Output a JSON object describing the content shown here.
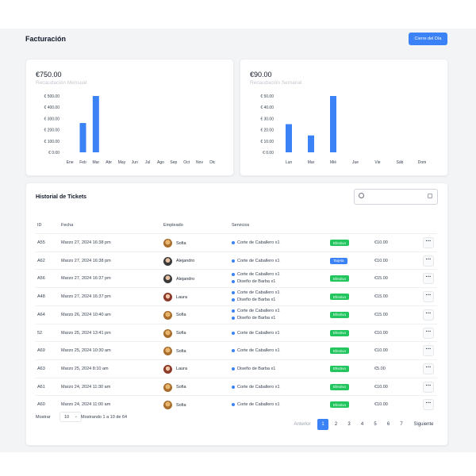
{
  "header": {
    "title": "Facturación",
    "close_button": "Cierre del Día"
  },
  "cards": [
    {
      "value": "€750.00",
      "label": "Recaudación Mensual"
    },
    {
      "value": "€90.00",
      "label": "Recaudación Semanal"
    }
  ],
  "colors": {
    "accent": "#3b82f6",
    "success": "#22c55e",
    "background": "#f3f4f6"
  },
  "chart_data": [
    {
      "type": "bar",
      "categories": [
        "Ene",
        "Feb",
        "Mar",
        "Abr",
        "May",
        "Jun",
        "Jul",
        "Ago",
        "Sep",
        "Oct",
        "Nov",
        "Dic"
      ],
      "values": [
        0,
        260,
        500,
        0,
        0,
        0,
        0,
        0,
        0,
        0,
        0,
        0
      ],
      "yticks": [
        "€ 500.00",
        "€ 400.00",
        "€ 300.00",
        "€ 200.00",
        "€ 100.00",
        "€ 0.00"
      ],
      "ylim": [
        0,
        500
      ],
      "grid": false
    },
    {
      "type": "bar",
      "categories": [
        "Lun",
        "Mar",
        "Mié",
        "Jue",
        "Vie",
        "Sáb",
        "Dom"
      ],
      "values": [
        25,
        15,
        50,
        0,
        0,
        0,
        0
      ],
      "yticks": [
        "€ 50.00",
        "€ 40.00",
        "€ 30.00",
        "€ 20.00",
        "€ 10.00",
        "€ 0.00"
      ],
      "ylim": [
        0,
        50
      ],
      "grid": false
    }
  ],
  "history": {
    "title": "Historial de Tickets",
    "columns": [
      "ID",
      "Fecha",
      "Empleado",
      "Servicios"
    ],
    "rows": [
      {
        "id": "A55",
        "date": "Marzo 27, 2024 16:38 pm",
        "employee": "Sofia",
        "avatar": "gold",
        "services": [
          "Corte de Caballero x1"
        ],
        "payment": "Efectivo",
        "amount": "€10.00"
      },
      {
        "id": "A62",
        "date": "Marzo 27, 2024 16:38 pm",
        "employee": "Alejandro",
        "avatar": "dark",
        "services": [
          "Corte de Caballero x1"
        ],
        "payment": "Tarjeta",
        "amount": "€10.00"
      },
      {
        "id": "A56",
        "date": "Marzo 27, 2024 16:37 pm",
        "employee": "Alejandro",
        "avatar": "dark",
        "services": [
          "Corte de Caballero x1",
          "Diseño de Barba x1"
        ],
        "payment": "Efectivo",
        "amount": "€15.00"
      },
      {
        "id": "A48",
        "date": "Marzo 27, 2024 16:37 pm",
        "employee": "Laura",
        "avatar": "red",
        "services": [
          "Corte de Caballero x1",
          "Diseño de Barba x1"
        ],
        "payment": "Efectivo",
        "amount": "€15.00"
      },
      {
        "id": "A64",
        "date": "Marzo 26, 2024 10:40 am",
        "employee": "Sofia",
        "avatar": "gold",
        "services": [
          "Corte de Caballero x1",
          "Diseño de Barba x1"
        ],
        "payment": "Efectivo",
        "amount": "€15.00"
      },
      {
        "id": "52",
        "date": "Marzo 25, 2024 13:41 pm",
        "employee": "Sofia",
        "avatar": "gold",
        "services": [
          "Corte de Caballero x1"
        ],
        "payment": "Efectivo",
        "amount": "€10.00"
      },
      {
        "id": "A69",
        "date": "Marzo 25, 2024 10:30 am",
        "employee": "Sofia",
        "avatar": "gold",
        "services": [
          "Corte de Caballero x1"
        ],
        "payment": "Efectivo",
        "amount": "€10.00"
      },
      {
        "id": "A63",
        "date": "Marzo 25, 2024 8:10 am",
        "employee": "Laura",
        "avatar": "red",
        "services": [
          "Diseño de Barba x1"
        ],
        "payment": "Efectivo",
        "amount": "€5.00"
      },
      {
        "id": "A61",
        "date": "Marzo 24, 2024 11:30 am",
        "employee": "Sofia",
        "avatar": "gold",
        "services": [
          "Corte de Caballero x1"
        ],
        "payment": "Efectivo",
        "amount": "€10.00"
      },
      {
        "id": "A60",
        "date": "Marzo 24, 2024 11:00 am",
        "employee": "Sofia",
        "avatar": "gold",
        "services": [
          "Corte de Caballero x1"
        ],
        "payment": "Efectivo",
        "amount": "€10.00"
      }
    ],
    "more_icon": "ellipsis-icon",
    "footer": {
      "show_label": "Mostrar",
      "page_size": "10",
      "range_text": "Mostrando 1 a 10 de 64",
      "prev": "Anterior",
      "next": "Siguiente",
      "pages": [
        "1",
        "2",
        "3",
        "4",
        "5",
        "6",
        "7"
      ],
      "current_page": "1"
    }
  }
}
